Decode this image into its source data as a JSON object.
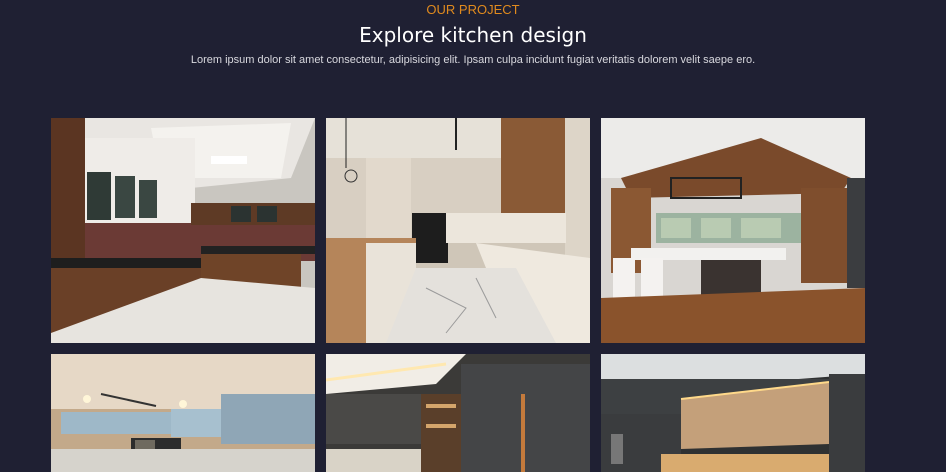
{
  "section": {
    "eyebrow": "OUR PROJECT",
    "title": "Explore kitchen design",
    "subtitle": "Lorem ipsum dolor sit amet consectetur, adipisicing elit. Ipsam culpa incidunt fugiat veritatis dolorem velit saepe ero."
  },
  "colors": {
    "background": "#1f2033",
    "accent": "#e08a1e"
  },
  "gallery": {
    "images": [
      {
        "icon": "kitchen-photo"
      },
      {
        "icon": "kitchen-photo"
      },
      {
        "icon": "kitchen-photo"
      },
      {
        "icon": "kitchen-photo"
      },
      {
        "icon": "kitchen-photo"
      },
      {
        "icon": "kitchen-photo"
      }
    ]
  }
}
